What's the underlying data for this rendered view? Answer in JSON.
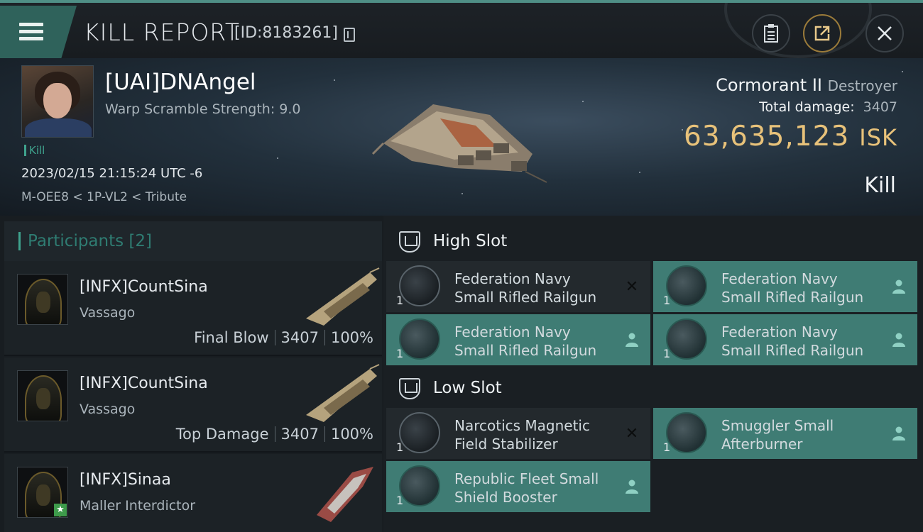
{
  "header": {
    "title": "KILL REPORT",
    "report_id": "[ID:8183261]"
  },
  "victim": {
    "name": "[UAI]DNAngel",
    "warp_scramble": "Warp Scramble Strength: 9.0",
    "tag": "Kill",
    "datetime": "2023/02/15 21:15:24 UTC -6",
    "location": "M-OEE8 < 1P-VL2 < Tribute",
    "ship_name": "Cormorant II",
    "ship_class": "Destroyer",
    "total_damage_label": "Total damage:",
    "total_damage": "3407",
    "isk_value": "63,635,123",
    "isk_unit": "ISK",
    "result": "Kill"
  },
  "participants": {
    "title": "Participants [2]",
    "rows": [
      {
        "name": "[INFX]CountSina",
        "ship": "Vassago",
        "role": "Final Blow",
        "damage": "3407",
        "percent": "100%"
      },
      {
        "name": "[INFX]CountSina",
        "ship": "Vassago",
        "role": "Top Damage",
        "damage": "3407",
        "percent": "100%"
      },
      {
        "name": "[INFX]Sinaa",
        "ship": "Maller Interdictor"
      }
    ]
  },
  "fitting": {
    "high_slot": {
      "label": "High Slot",
      "items": [
        {
          "line1": "Federation Navy",
          "line2": "Small Rifled Railgun",
          "qty": "1",
          "state": "destroyed",
          "icon": "railgun-icon"
        },
        {
          "line1": "Federation Navy",
          "line2": "Small Rifled Railgun",
          "qty": "1",
          "state": "dropped",
          "icon": "railgun-icon"
        },
        {
          "line1": "Federation Navy",
          "line2": "Small Rifled Railgun",
          "qty": "1",
          "state": "dropped",
          "icon": "railgun-icon"
        },
        {
          "line1": "Federation Navy",
          "line2": "Small Rifled Railgun",
          "qty": "1",
          "state": "dropped",
          "icon": "railgun-icon"
        }
      ]
    },
    "low_slot": {
      "label": "Low Slot",
      "items": [
        {
          "line1": "Narcotics Magnetic",
          "line2": "Field Stabilizer",
          "qty": "1",
          "state": "destroyed",
          "icon": "magnetic-stabilizer-icon"
        },
        {
          "line1": "Smuggler Small",
          "line2": "Afterburner",
          "qty": "1",
          "state": "dropped",
          "icon": "afterburner-icon"
        },
        {
          "line1": "Republic Fleet Small",
          "line2": "Shield Booster",
          "qty": "1",
          "state": "dropped",
          "icon": "shield-booster-icon"
        }
      ]
    }
  },
  "colors": {
    "accent_teal": "#3f7c74",
    "isk_gold": "#e8c27a",
    "menu_green": "#2f625b"
  }
}
